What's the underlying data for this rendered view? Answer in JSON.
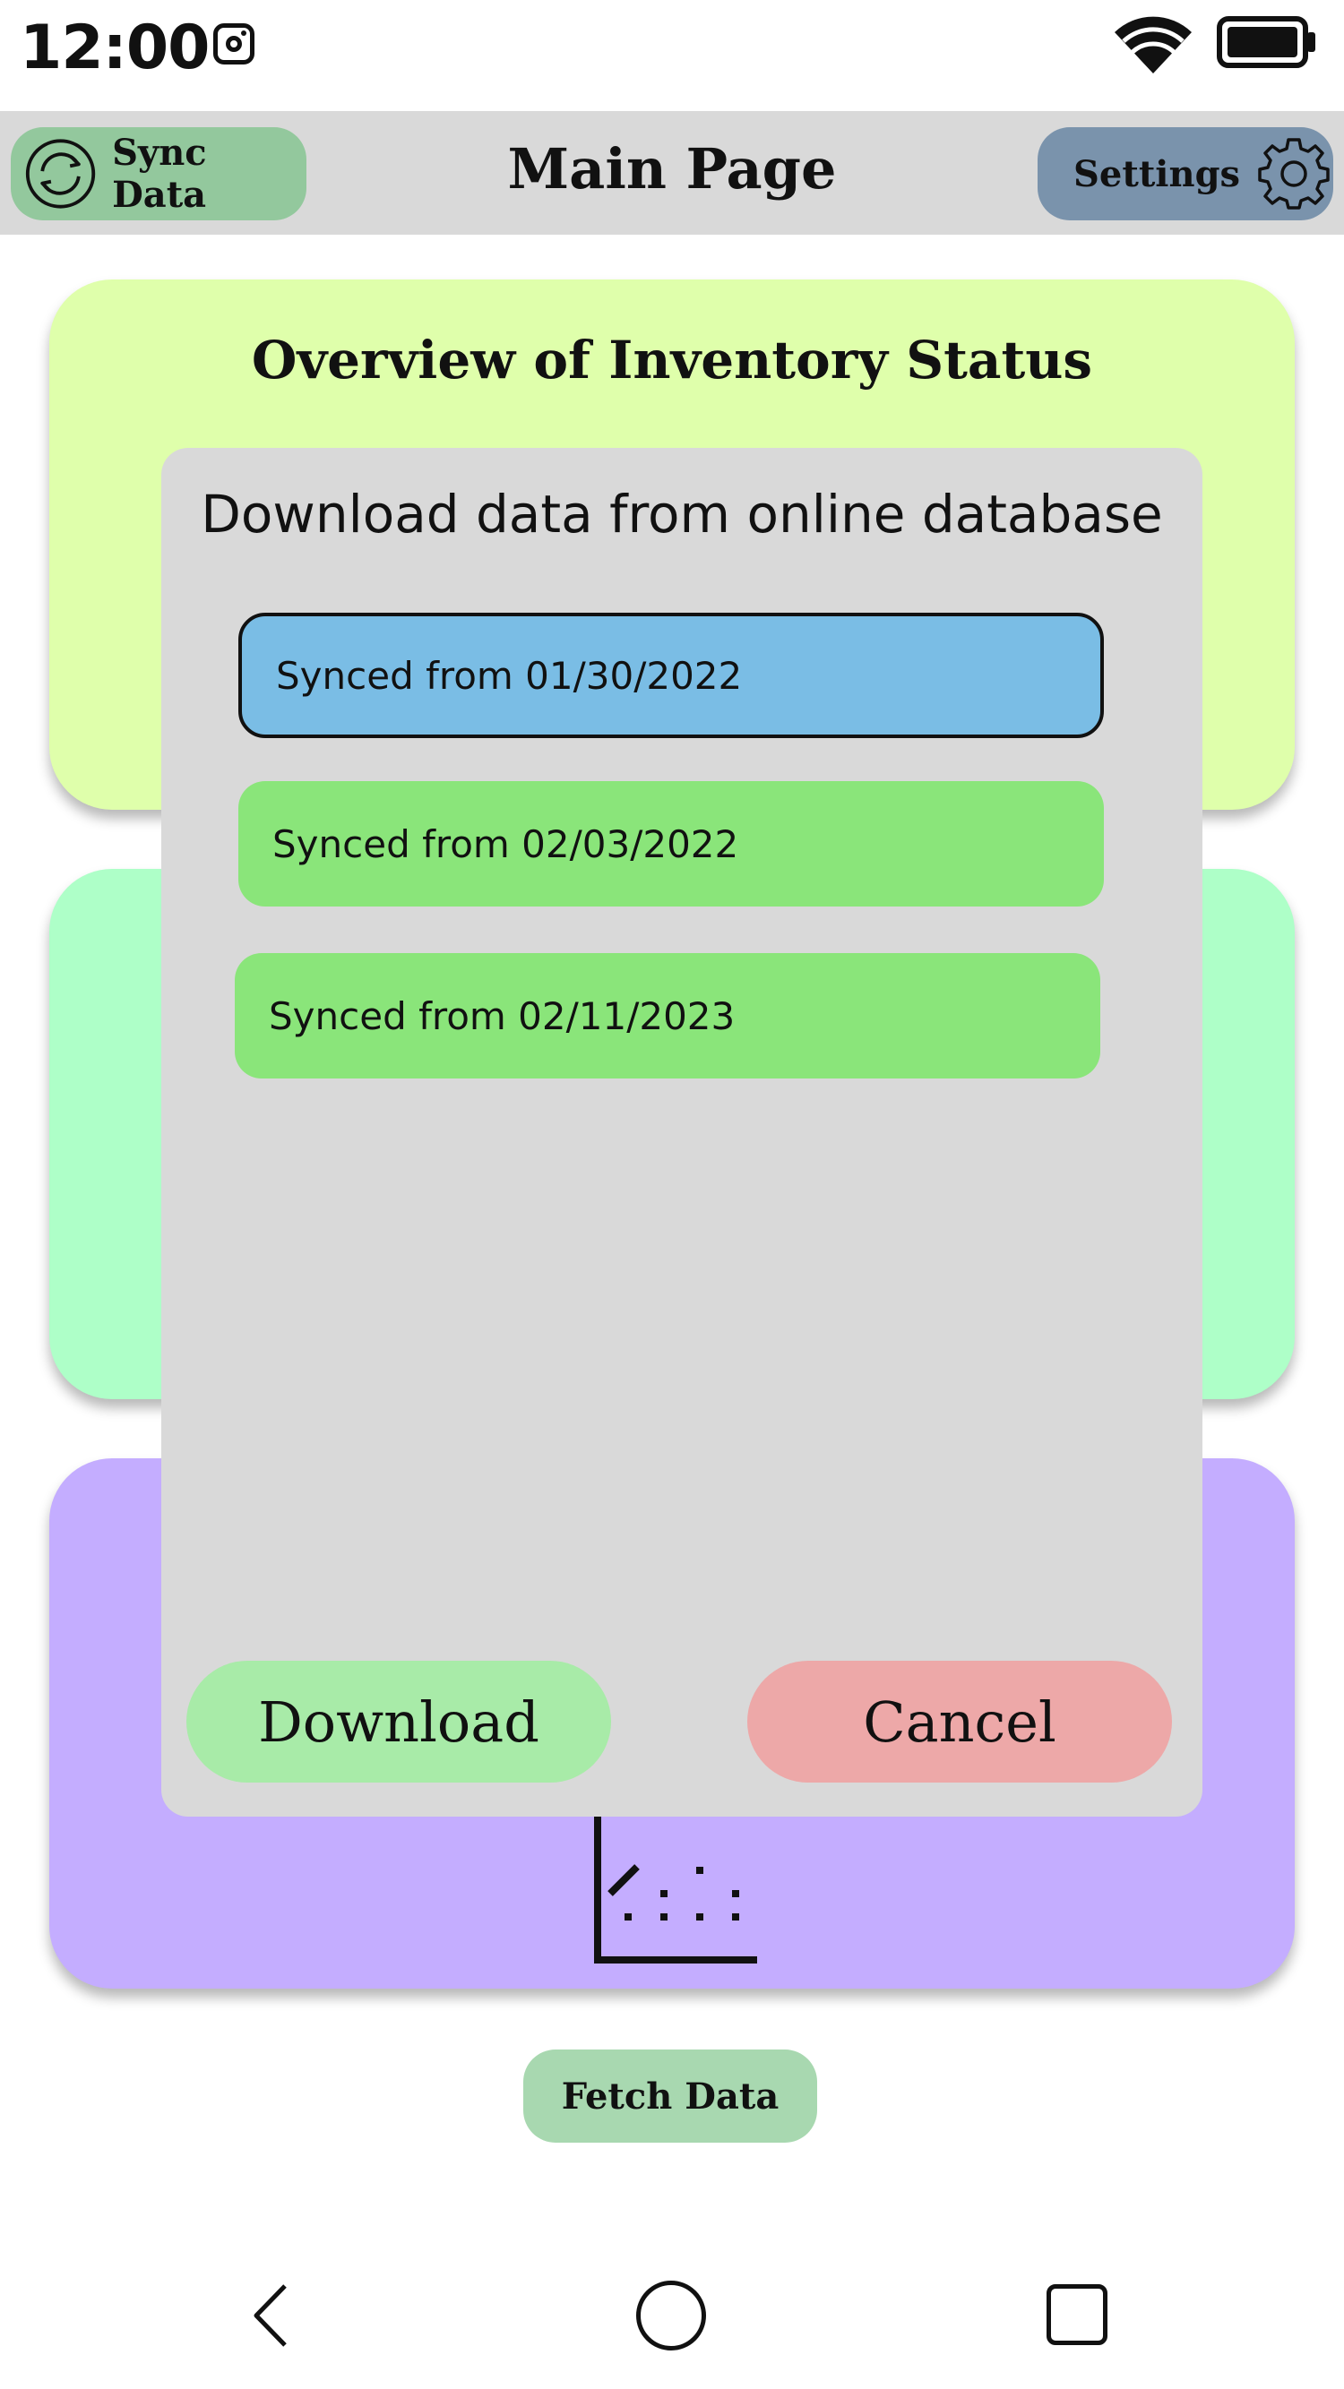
{
  "status_bar": {
    "time": "12:00",
    "icons": [
      "instagram-icon",
      "wifi-icon",
      "battery-icon"
    ]
  },
  "header": {
    "sync_button_label": "Sync Data",
    "sync_icon": "sync-icon",
    "title": "Main Page",
    "settings_button_label": "Settings",
    "settings_icon": "gear-icon"
  },
  "cards": [
    {
      "title": "Overview of Inventory Status",
      "color": "#dfffab"
    },
    {
      "title": "",
      "color": "#aeffc8"
    },
    {
      "title": "",
      "color": "#c4adff",
      "icon": "chart-icon"
    }
  ],
  "dialog": {
    "title": "Download data from online database",
    "options": [
      {
        "label": "Synced from 01/30/2022",
        "selected": true,
        "color": "#7abde5"
      },
      {
        "label": "Synced from 02/03/2022",
        "selected": false,
        "color": "#8ae57a"
      },
      {
        "label": "Synced from 02/11/2023",
        "selected": false,
        "color": "#8ae57a"
      }
    ],
    "download_label": "Download",
    "cancel_label": "Cancel"
  },
  "fetch_button_label": "Fetch Data",
  "nav": {
    "back_icon": "back-icon",
    "home_icon": "home-icon",
    "recent_icon": "recent-apps-icon"
  }
}
